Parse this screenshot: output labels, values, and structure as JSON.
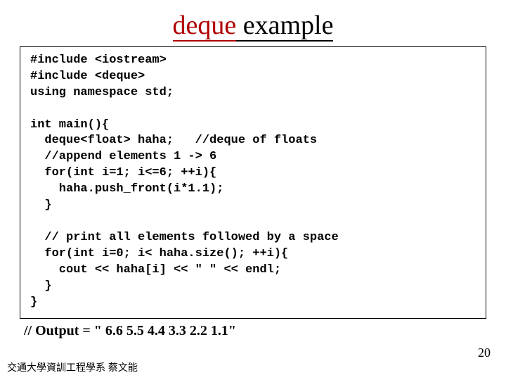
{
  "title": {
    "keyword": "deque",
    "rest": "  example"
  },
  "code": {
    "block1": "#include <iostream>\n#include <deque>\nusing namespace std;",
    "block2": "int main(){\n  deque<float> haha;   //deque of floats\n  //append elements 1 -> 6\n  for(int i=1; i<=6; ++i){\n    haha.push_front(i*1.1);\n  }",
    "block3": "  // print all elements followed by a space\n  for(int i=0; i< haha.size(); ++i){\n    cout << haha[i] << \" \" << endl;\n  }\n}"
  },
  "output": "// Output = \" 6.6 5.5 4.4 3.3 2.2 1.1\"",
  "footer": "交通大學資訓工程學系 蔡文能",
  "page": "20"
}
